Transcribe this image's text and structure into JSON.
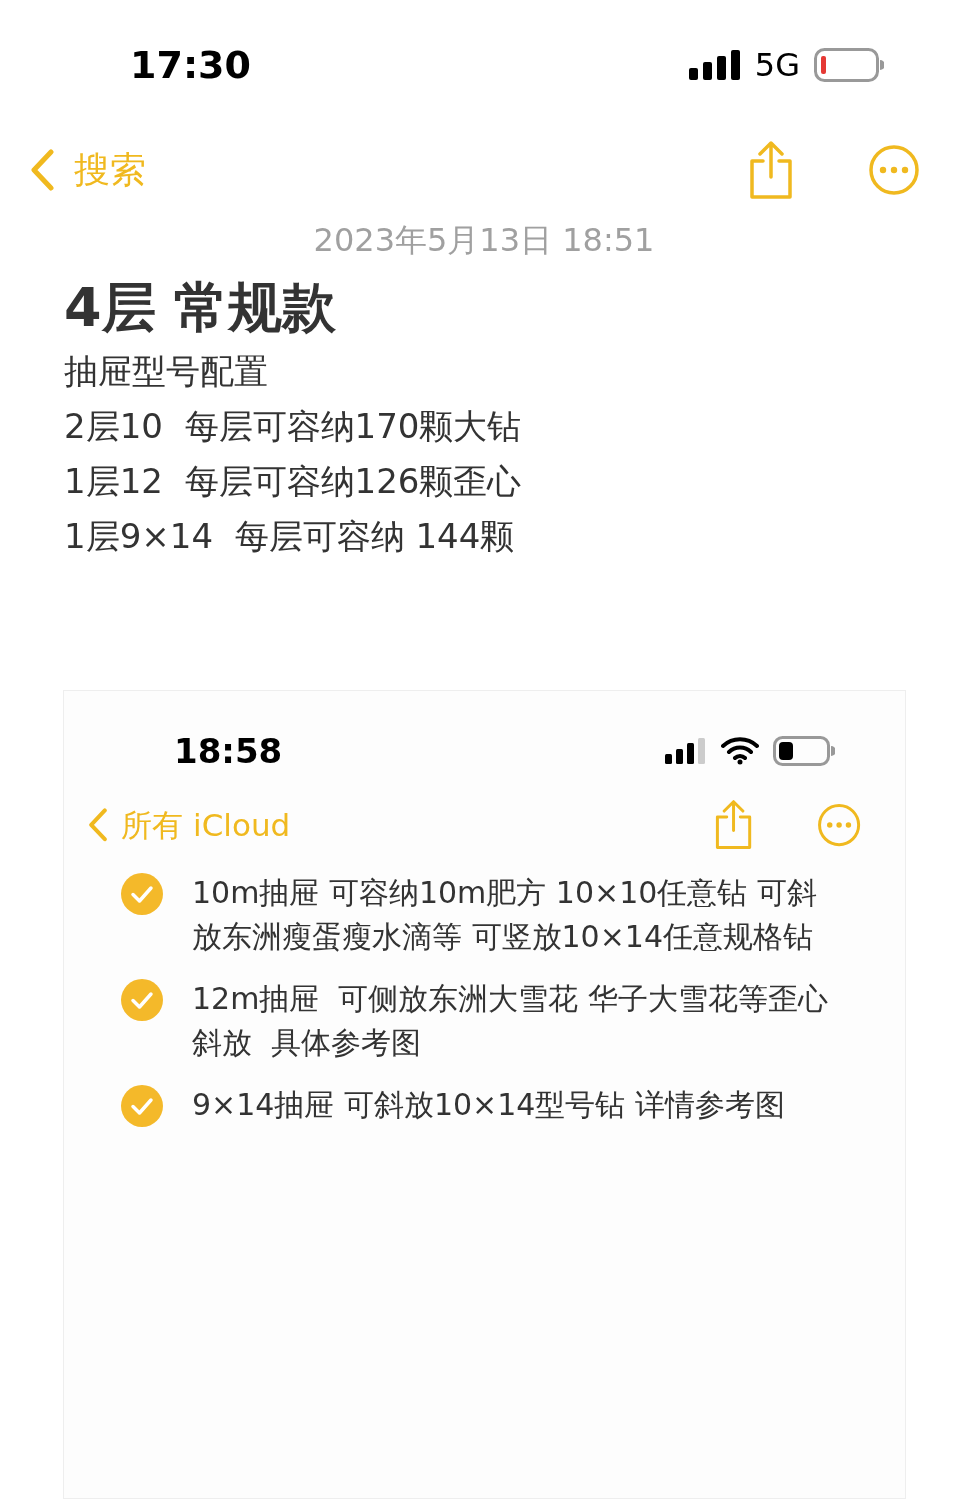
{
  "status_bar": {
    "time": "17:30",
    "network": "5G"
  },
  "nav": {
    "back_label": "搜索"
  },
  "note": {
    "date": "2023年5月13日 18:51",
    "title": "4层 常规款",
    "lines": [
      "抽屉型号配置",
      "2层10  每层可容纳170颗大钻",
      "1层12  每层可容纳126颗歪心",
      "1层9×14  每层可容纳 144颗"
    ]
  },
  "embedded_screenshot": {
    "status_bar": {
      "time": "18:58"
    },
    "nav": {
      "back_label": "所有 iCloud"
    },
    "checklist": [
      {
        "text": "10m抽屉 可容纳10m肥方 10×10任意钻 可斜放东洲瘦蛋瘦水滴等 可竖放10×14任意规格钻",
        "checked": true
      },
      {
        "text": "12m抽屉  可侧放东洲大雪花 华子大雪花等歪心斜放  具体参考图",
        "checked": true
      },
      {
        "text": "9×14抽屉 可斜放10×14型号钻 详情参考图",
        "checked": true
      }
    ]
  }
}
